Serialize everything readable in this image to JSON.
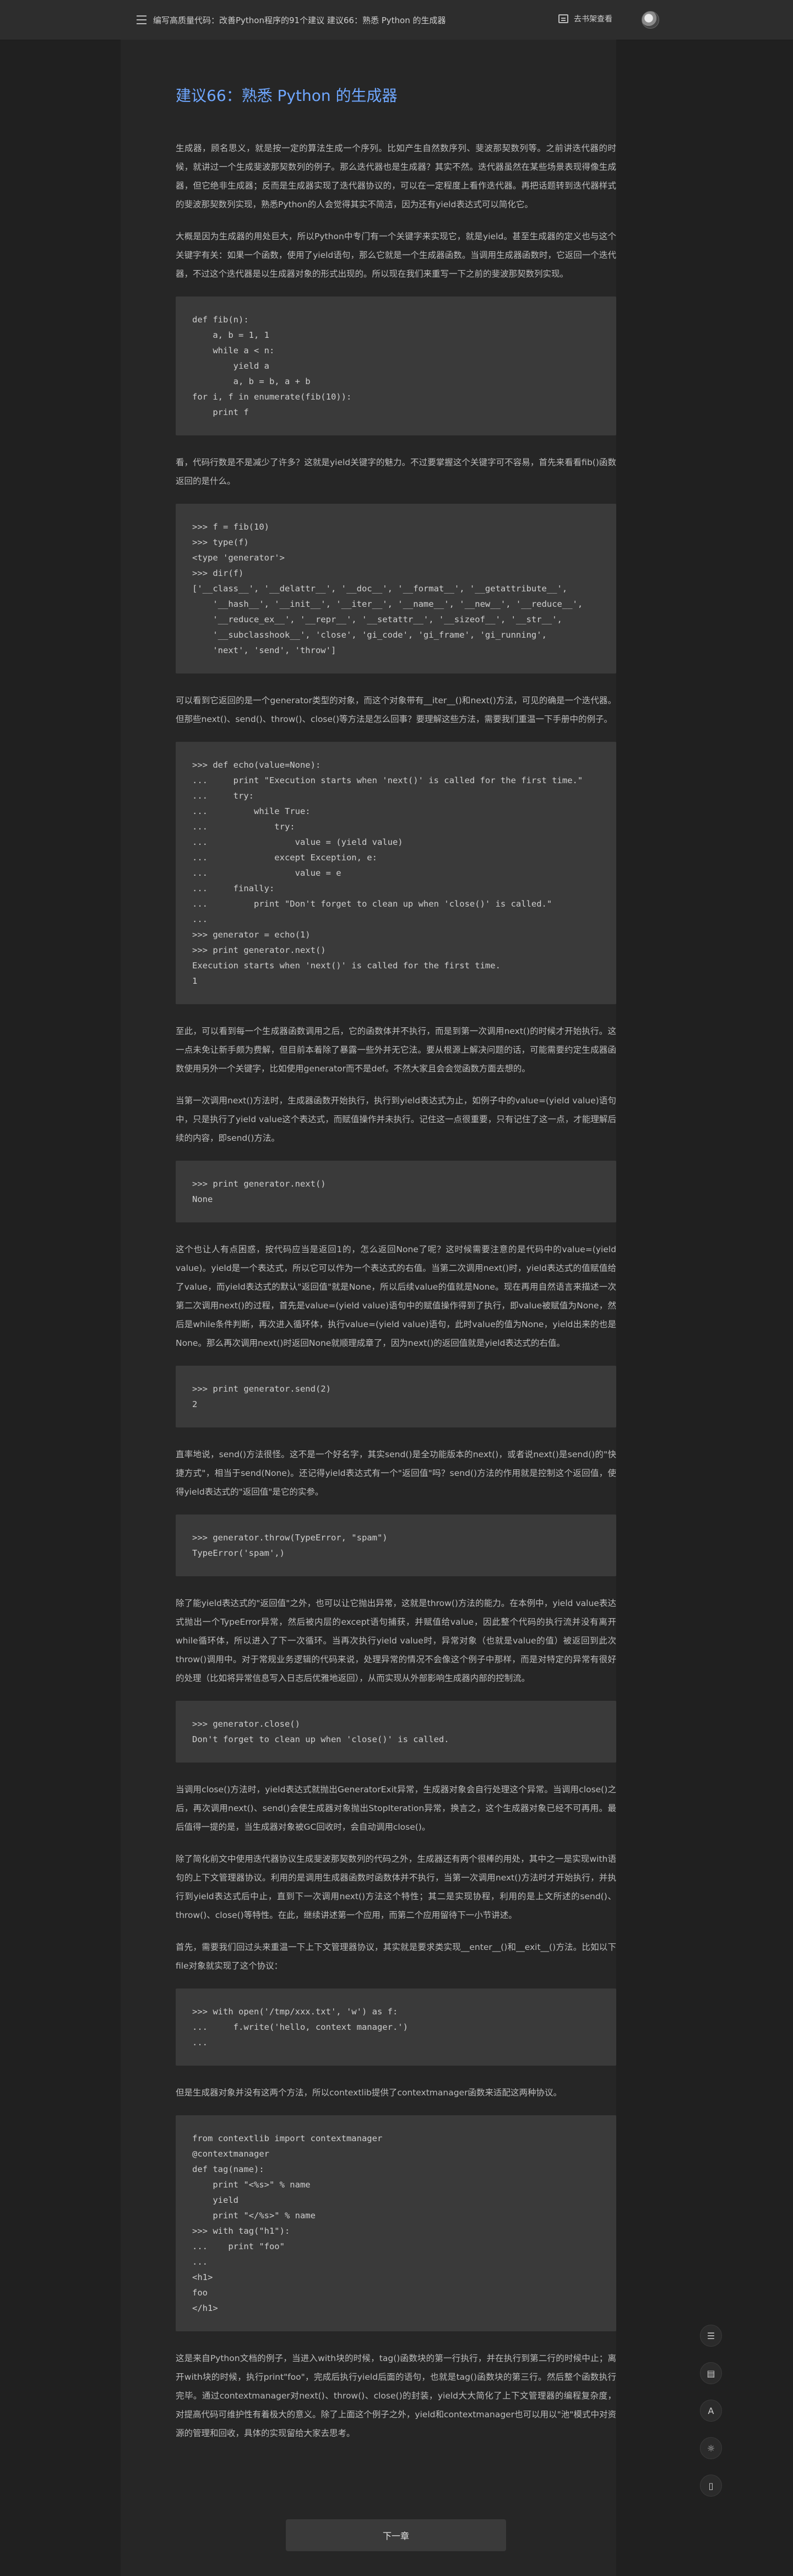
{
  "topbar": {
    "title": "编写高质量代码：改善Python程序的91个建议 建议66：熟悉 Python 的生成器",
    "listen_label": "去书架查看"
  },
  "article": {
    "heading": "建议66：熟悉 Python 的生成器",
    "paragraphs": [
      "生成器，顾名思义，就是按一定的算法生成一个序列。比如产生自然数序列、斐波那契数列等。之前讲迭代器的时候，就讲过一个生成斐波那契数列的例子。那么迭代器也是生成器？其实不然。迭代器虽然在某些场景表现得像生成器，但它绝非生成器；反而是生成器实现了迭代器协议的，可以在一定程度上看作迭代器。再把话题转到迭代器样式的斐波那契数列实现，熟悉Python的人会觉得其实不简洁，因为还有yield表达式可以简化它。",
      "大概是因为生成器的用处巨大，所以Python中专门有一个关键字来实现它，就是yield。甚至生成器的定义也与这个关键字有关：如果一个函数，使用了yield语句，那么它就是一个生成器函数。当调用生成器函数时，它返回一个迭代器，不过这个迭代器是以生成器对象的形式出现的。所以现在我们来重写一下之前的斐波那契数列实现。",
      "看，代码行数是不是减少了许多？这就是yield关键字的魅力。不过要掌握这个关键字可不容易，首先来看看fib()函数返回的是什么。",
      "可以看到它返回的是一个generator类型的对象，而这个对象带有__iter__()和next()方法，可见的确是一个迭代器。但那些next()、send()、throw()、close()等方法是怎么回事？要理解这些方法，需要我们重温一下手册中的例子。",
      "至此，可以看到每一个生成器函数调用之后，它的函数体并不执行，而是到第一次调用next()的时候才开始执行。这一点未免让新手颇为费解，但目前本着除了暴露一些外并无它法。要从根源上解决问题的话，可能需要约定生成器函数使用另外一个关键字，比如使用generator而不是def。不然大家且会会觉函数方面去想的。",
      "当第一次调用next()方法时，生成器函数开始执行，执行到yield表达式为止，如例子中的value=(yield value)语句中，只是执行了yield value这个表达式，而赋值操作并未执行。记住这一点很重要，只有记住了这一点，才能理解后续的内容，即send()方法。",
      "这个也让人有点困惑，按代码应当是返回1的，怎么返回None了呢？这时候需要注意的是代码中的value=(yield value)。yield是一个表达式，所以它可以作为一个表达式的右值。当第二次调用next()时，yield表达式的值赋值给了value，而yield表达式的默认\"返回值\"就是None，所以后续value的值就是None。现在再用自然语言来描述一次第二次调用next()的过程，首先是value=(yield value)语句中的赋值操作得到了执行，即value被赋值为None，然后是while条件判断，再次进入循环体，执行value=(yield value)语句，此时value的值为None，yield出来的也是None。那么再次调用next()时返回None就顺理成章了，因为next()的返回值就是yield表达式的右值。",
      "直率地说，send()方法很怪。这不是一个好名字，其实send()是全功能版本的next()，或者说next()是send()的\"快捷方式\"，相当于send(None)。还记得yield表达式有一个\"返回值\"吗？send()方法的作用就是控制这个返回值，使得yield表达式的\"返回值\"是它的实参。",
      "除了能yield表达式的\"返回值\"之外，也可以让它抛出异常，这就是throw()方法的能力。在本例中，yield value表达式抛出一个TypeError异常，然后被内层的except语句捕获，并赋值给value，因此整个代码的执行流并没有离开while循环体，所以进入了下一次循环。当再次执行yield value时，异常对象（也就是value的值）被返回到此次throw()调用中。对于常规业务逻辑的代码来说，处理异常的情况不会像这个例子中那样，而是对特定的异常有很好的处理（比如将异常信息写入日志后优雅地返回），从而实现从外部影响生成器内部的控制流。",
      "当调用close()方法时，yield表达式就抛出GeneratorExit异常，生成器对象会自行处理这个异常。当调用close()之后，再次调用next()、send()会使生成器对象抛出StopIteration异常，换言之，这个生成器对象已经不可再用。最后值得一提的是，当生成器对象被GC回收时，会自动调用close()。",
      "除了简化前文中使用迭代器协议生成斐波那契数列的代码之外，生成器还有两个很棒的用处，其中之一是实现with语句的上下文管理器协议。利用的是调用生成器函数时函数体并不执行，当第一次调用next()方法时才开始执行，并执行到yield表达式后中止，直到下一次调用next()方法这个特性；其二是实现协程，利用的是上文所述的send()、throw()、close()等特性。在此，继续讲述第一个应用，而第二个应用留待下一小节讲述。",
      "首先，需要我们回过头来重温一下上下文管理器协议，其实就是要求类实现__enter__()和__exit__()方法。比如以下file对象就实现了这个协议：",
      "但是生成器对象并没有这两个方法，所以contextlib提供了contextmanager函数来适配这两种协议。",
      "这是来自Python文档的例子，当进入with块的时候，tag()函数块的第一行执行，并在执行到第二行的时候中止；离开with块的时候，执行print\"foo\"，完成后执行yield后面的语句，也就是tag()函数块的第三行。然后整个函数执行完毕。通过contextmanager对next()、throw()、close()的封装，yield大大简化了上下文管理器的编程复杂度，对提高代码可维护性有着极大的意义。除了上面这个例子之外，yield和contextmanager也可以用以\"池\"模式中对资源的管理和回收，具体的实现留给大家去思考。"
    ],
    "code_blocks": [
      "def fib(n):\n    a, b = 1, 1\n    while a < n:\n        yield a\n        a, b = b, a + b\nfor i, f in enumerate(fib(10)):\n    print f",
      ">>> f = fib(10)\n>>> type(f)\n<type 'generator'>\n>>> dir(f)\n['__class__', '__delattr__', '__doc__', '__format__', '__getattribute__',\n    '__hash__', '__init__', '__iter__', '__name__', '__new__', '__reduce__',\n    '__reduce_ex__', '__repr__', '__setattr__', '__sizeof__', '__str__',\n    '__subclasshook__', 'close', 'gi_code', 'gi_frame', 'gi_running',\n    'next', 'send', 'throw']",
      ">>> def echo(value=None):\n...     print \"Execution starts when 'next()' is called for the first time.\"\n...     try:\n...         while True:\n...             try:\n...                 value = (yield value)\n...             except Exception, e:\n...                 value = e\n...     finally:\n...         print \"Don't forget to clean up when 'close()' is called.\"\n...\n>>> generator = echo(1)\n>>> print generator.next()\nExecution starts when 'next()' is called for the first time.\n1",
      ">>> print generator.next()\nNone",
      ">>> print generator.send(2)\n2",
      ">>> generator.throw(TypeError, \"spam\")\nTypeError('spam',)",
      ">>> generator.close()\nDon't forget to clean up when 'close()' is called.",
      ">>> with open('/tmp/xxx.txt', 'w') as f:\n...     f.write('hello, context manager.')\n...",
      "from contextlib import contextmanager\n@contextmanager\ndef tag(name):\n    print \"<%s>\" % name\n    yield\n    print \"</%s>\" % name\n>>> with tag(\"h1\"):\n...    print \"foo\"\n...\n<h1>\nfoo\n</h1>"
    ]
  },
  "floating_buttons": [
    "list-icon",
    "comment-icon",
    "font-icon",
    "brightness-icon",
    "phone-icon"
  ],
  "floating_labels": {
    "font": "A"
  },
  "next_label": "下一章"
}
